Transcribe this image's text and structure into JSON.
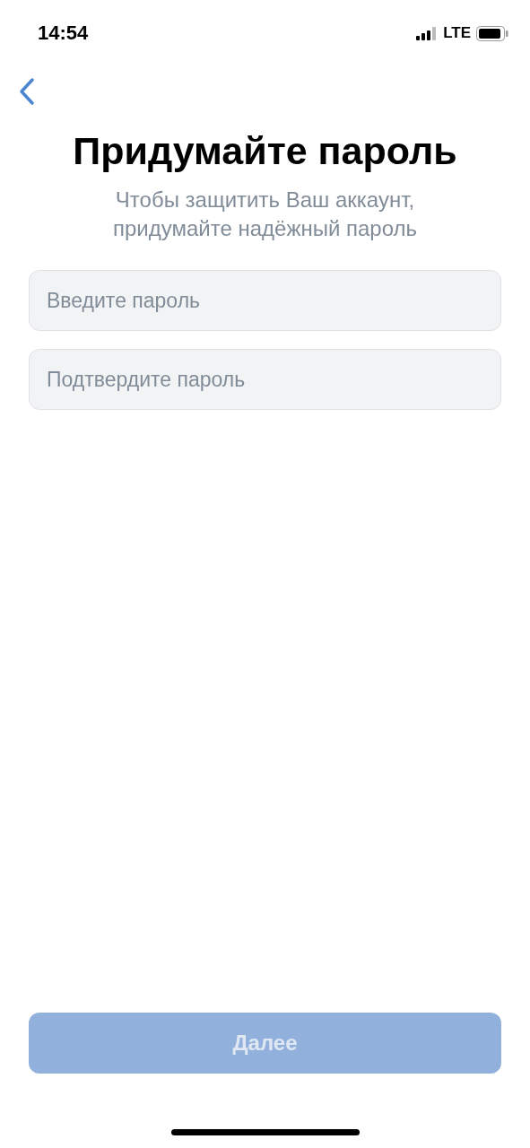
{
  "status_bar": {
    "time": "14:54",
    "network": "LTE"
  },
  "title": "Придумайте пароль",
  "subtitle": "Чтобы защитить Ваш аккаунт, придумайте надёжный пароль",
  "fields": [
    {
      "placeholder": "Введите пароль"
    },
    {
      "placeholder": "Подтвердите пароль"
    }
  ],
  "next_button": {
    "label": "Далее",
    "disabled": true
  }
}
